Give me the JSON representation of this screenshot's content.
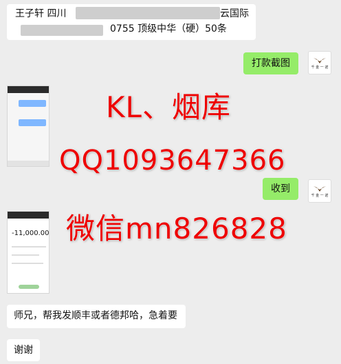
{
  "header": {
    "line1": "王子轩 四川",
    "line1_tail": "云国际",
    "line2": "0755 顶级中华（硬）50条"
  },
  "messages": {
    "screenshot_label": "打款截图",
    "received_label": "收到",
    "request": "师兄，帮我发顺丰或者德邦哈，急着要",
    "thanks": "谢谢"
  },
  "screenshot2": {
    "amount": "-11,000.00"
  },
  "watermark": {
    "line1": "KL、烟库",
    "line2": "QQ1093647366",
    "line3": "微信mn826828"
  },
  "colors": {
    "own_bubble": "#95ec69",
    "other_bubble": "#ffffff",
    "watermark": "#e00000",
    "background": "#ededed"
  }
}
